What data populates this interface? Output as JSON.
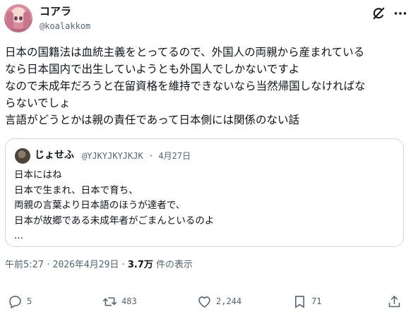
{
  "author": {
    "display_name": "コアラ",
    "handle": "@koalakkom"
  },
  "tweet": {
    "text": "日本の国籍法は血統主義をとってるので、外国人の両親から産まれている\nなら日本国内で出生していようとも外国人でしかないですよ\nなので未成年だろうと在留資格を維持できないなら当然帰国しなければな\nらないでしょ\n言語がどうとかは親の責任であって日本側には関係のない話"
  },
  "quote": {
    "display_name": "じょせふ",
    "handle": "@YJKYJKYJKJK",
    "separator": "·",
    "date": "4月27日",
    "text": "日本にはね\n日本で生まれ、日本で育ち、\n両親の言葉より日本語のほうが達者で、\n日本が故郷である未成年者がごまんといるのよ\n..."
  },
  "meta": {
    "time": "午前5:27",
    "dot1": "·",
    "date": "2026年4月29日",
    "dot2": "·",
    "views": "3.7万",
    "views_label": "件の表示"
  },
  "actions": {
    "reply_count": "5",
    "retweet_count": "483",
    "like_count": "2,244",
    "bookmark_count": "71"
  },
  "icons": {
    "grok": "grok-icon",
    "more": "more-icon",
    "reply": "reply-icon",
    "retweet": "retweet-icon",
    "like": "heart-icon",
    "bookmark": "bookmark-icon",
    "share": "share-icon"
  },
  "colors": {
    "text": "#0f1419",
    "secondary": "#536471",
    "border": "#cfd9de"
  }
}
